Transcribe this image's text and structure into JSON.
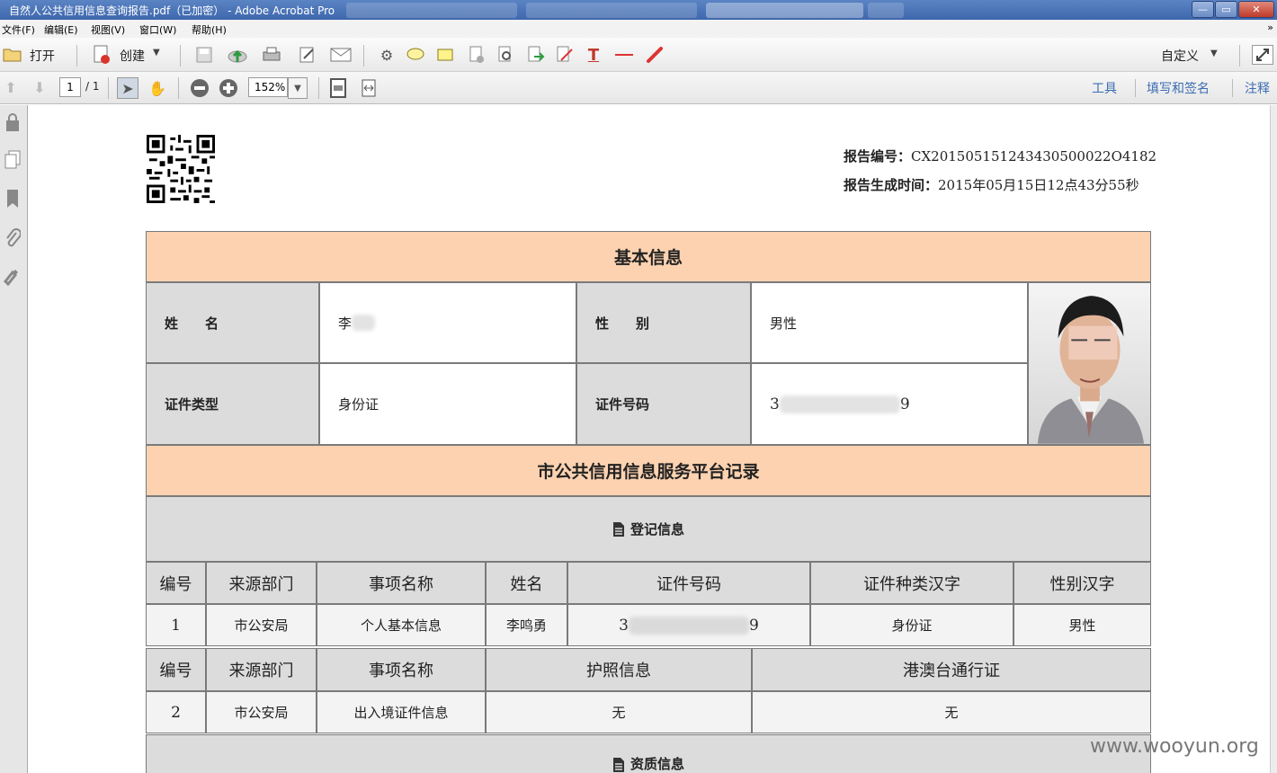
{
  "window": {
    "title": "自然人公共信用信息查询报告.pdf（已加密） - Adobe Acrobat Pro",
    "controls": {
      "minimize": "—",
      "maximize": "▭",
      "close": "✕"
    }
  },
  "menubar": {
    "items": [
      "文件(F)",
      "编辑(E)",
      "视图(V)",
      "窗口(W)",
      "帮助(H)"
    ],
    "overflow_arrow": "»"
  },
  "toolbar": {
    "open_label": "打开",
    "create_label": "创建",
    "customize_label": "自定义",
    "page_current": "1",
    "page_total": "/ 1",
    "zoom_value": "152%",
    "right_links": [
      "工具",
      "填写和签名",
      "注释"
    ]
  },
  "report": {
    "report_no_label": "报告编号：",
    "report_no_value": "CX201505151243430500022O4182",
    "report_time_label": "报告生成时间：",
    "report_time_value": "2015年05月15日12点43分55秒",
    "basic_info": {
      "header": "基本信息",
      "name_label": "姓　　名",
      "name_value": "李",
      "gender_label": "性　　别",
      "gender_value": "男性",
      "id_type_label": "证件类型",
      "id_type_value": "身份证",
      "id_no_label": "证件号码",
      "id_no_prefix": "3",
      "id_no_suffix": "9"
    },
    "platform": {
      "header": "市公共信用信息服务平台记录",
      "registration_header": "登记信息",
      "qualification_header": "资质信息"
    },
    "table1": {
      "headers": [
        "编号",
        "来源部门",
        "事项名称",
        "姓名",
        "证件号码",
        "证件种类汉字",
        "性别汉字"
      ],
      "row": {
        "no": "1",
        "dept": "市公安局",
        "item": "个人基本信息",
        "name": "李鸣勇",
        "id_prefix": "3",
        "id_suffix": "9",
        "id_kind": "身份证",
        "gender": "男性"
      }
    },
    "table2": {
      "headers": [
        "编号",
        "来源部门",
        "事项名称",
        "护照信息",
        "港澳台通行证"
      ],
      "row": {
        "no": "2",
        "dept": "市公安局",
        "item": "出入境证件信息",
        "passport": "无",
        "hk_permit": "无"
      }
    }
  },
  "watermark": "www.wooyun.org"
}
